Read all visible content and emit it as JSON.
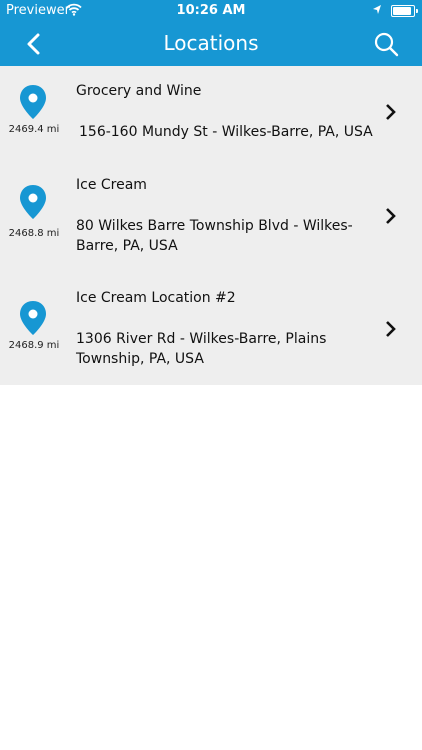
{
  "status": {
    "carrier": "Previewer",
    "time": "10:26 AM"
  },
  "navbar": {
    "title": "Locations"
  },
  "locations": [
    {
      "name": "Grocery and Wine",
      "address": "156-160 Mundy St - Wilkes-Barre, PA, USA",
      "distance": "2469.4 mi"
    },
    {
      "name": "Ice Cream",
      "address": "80 Wilkes Barre Township Blvd - Wilkes-Barre, PA, USA",
      "distance": "2468.8 mi"
    },
    {
      "name": "Ice Cream Location #2",
      "address": "1306 River Rd - Wilkes-Barre, Plains Township, PA, USA",
      "distance": "2468.9 mi"
    }
  ],
  "colors": {
    "header": "#1797d3",
    "pin": "#1797d3",
    "list_background": "#eeeeee"
  },
  "icons": {
    "back": "chevron-left-icon",
    "search": "search-icon",
    "pin": "map-pin-icon",
    "row_arrow": "chevron-right-icon"
  }
}
